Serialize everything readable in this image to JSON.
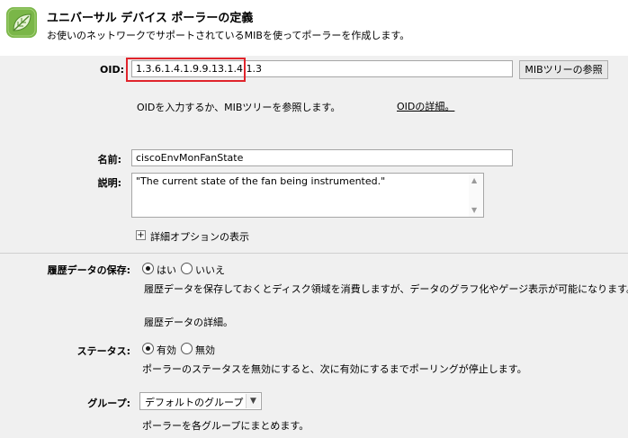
{
  "header": {
    "title": "ユニバーサル デバイス ポーラーの定義",
    "subtitle": "お使いのネットワークでサポートされているMIBを使ってポーラーを作成します。",
    "logo_icon": "green-leaf-logo-icon"
  },
  "oid": {
    "label": "OID:",
    "value": "1.3.6.1.4.1.9.9.13.1.4.1.3",
    "mib_button": "MIBツリーの参照",
    "hint": "OIDを入力するか、MIBツリーを参照します。",
    "details_link": "OIDの詳細。"
  },
  "name": {
    "label": "名前:",
    "value": "ciscoEnvMonFanState"
  },
  "description": {
    "label": "説明:",
    "value": "\"The current state of the fan being instrumented.\""
  },
  "advanced": {
    "toggle_label": "詳細オプションの表示"
  },
  "history": {
    "label": "履歴データの保存:",
    "options": [
      "はい",
      "いいえ"
    ],
    "selected": "はい",
    "help": "履歴データを保存しておくとディスク領域を消費しますが、データのグラフ化やゲージ表示が可能になります。",
    "details": "履歴データの詳細。"
  },
  "status": {
    "label": "ステータス:",
    "options": [
      "有効",
      "無効"
    ],
    "selected": "有効",
    "help": "ポーラーのステータスを無効にすると、次に有効にするまでポーリングが停止します。"
  },
  "group": {
    "label": "グループ:",
    "selected": "デフォルトのグループ",
    "help": "ポーラーを各グループにまとめます。"
  },
  "colors": {
    "highlight": "#e0242b",
    "logo_green": "#7ab648"
  }
}
